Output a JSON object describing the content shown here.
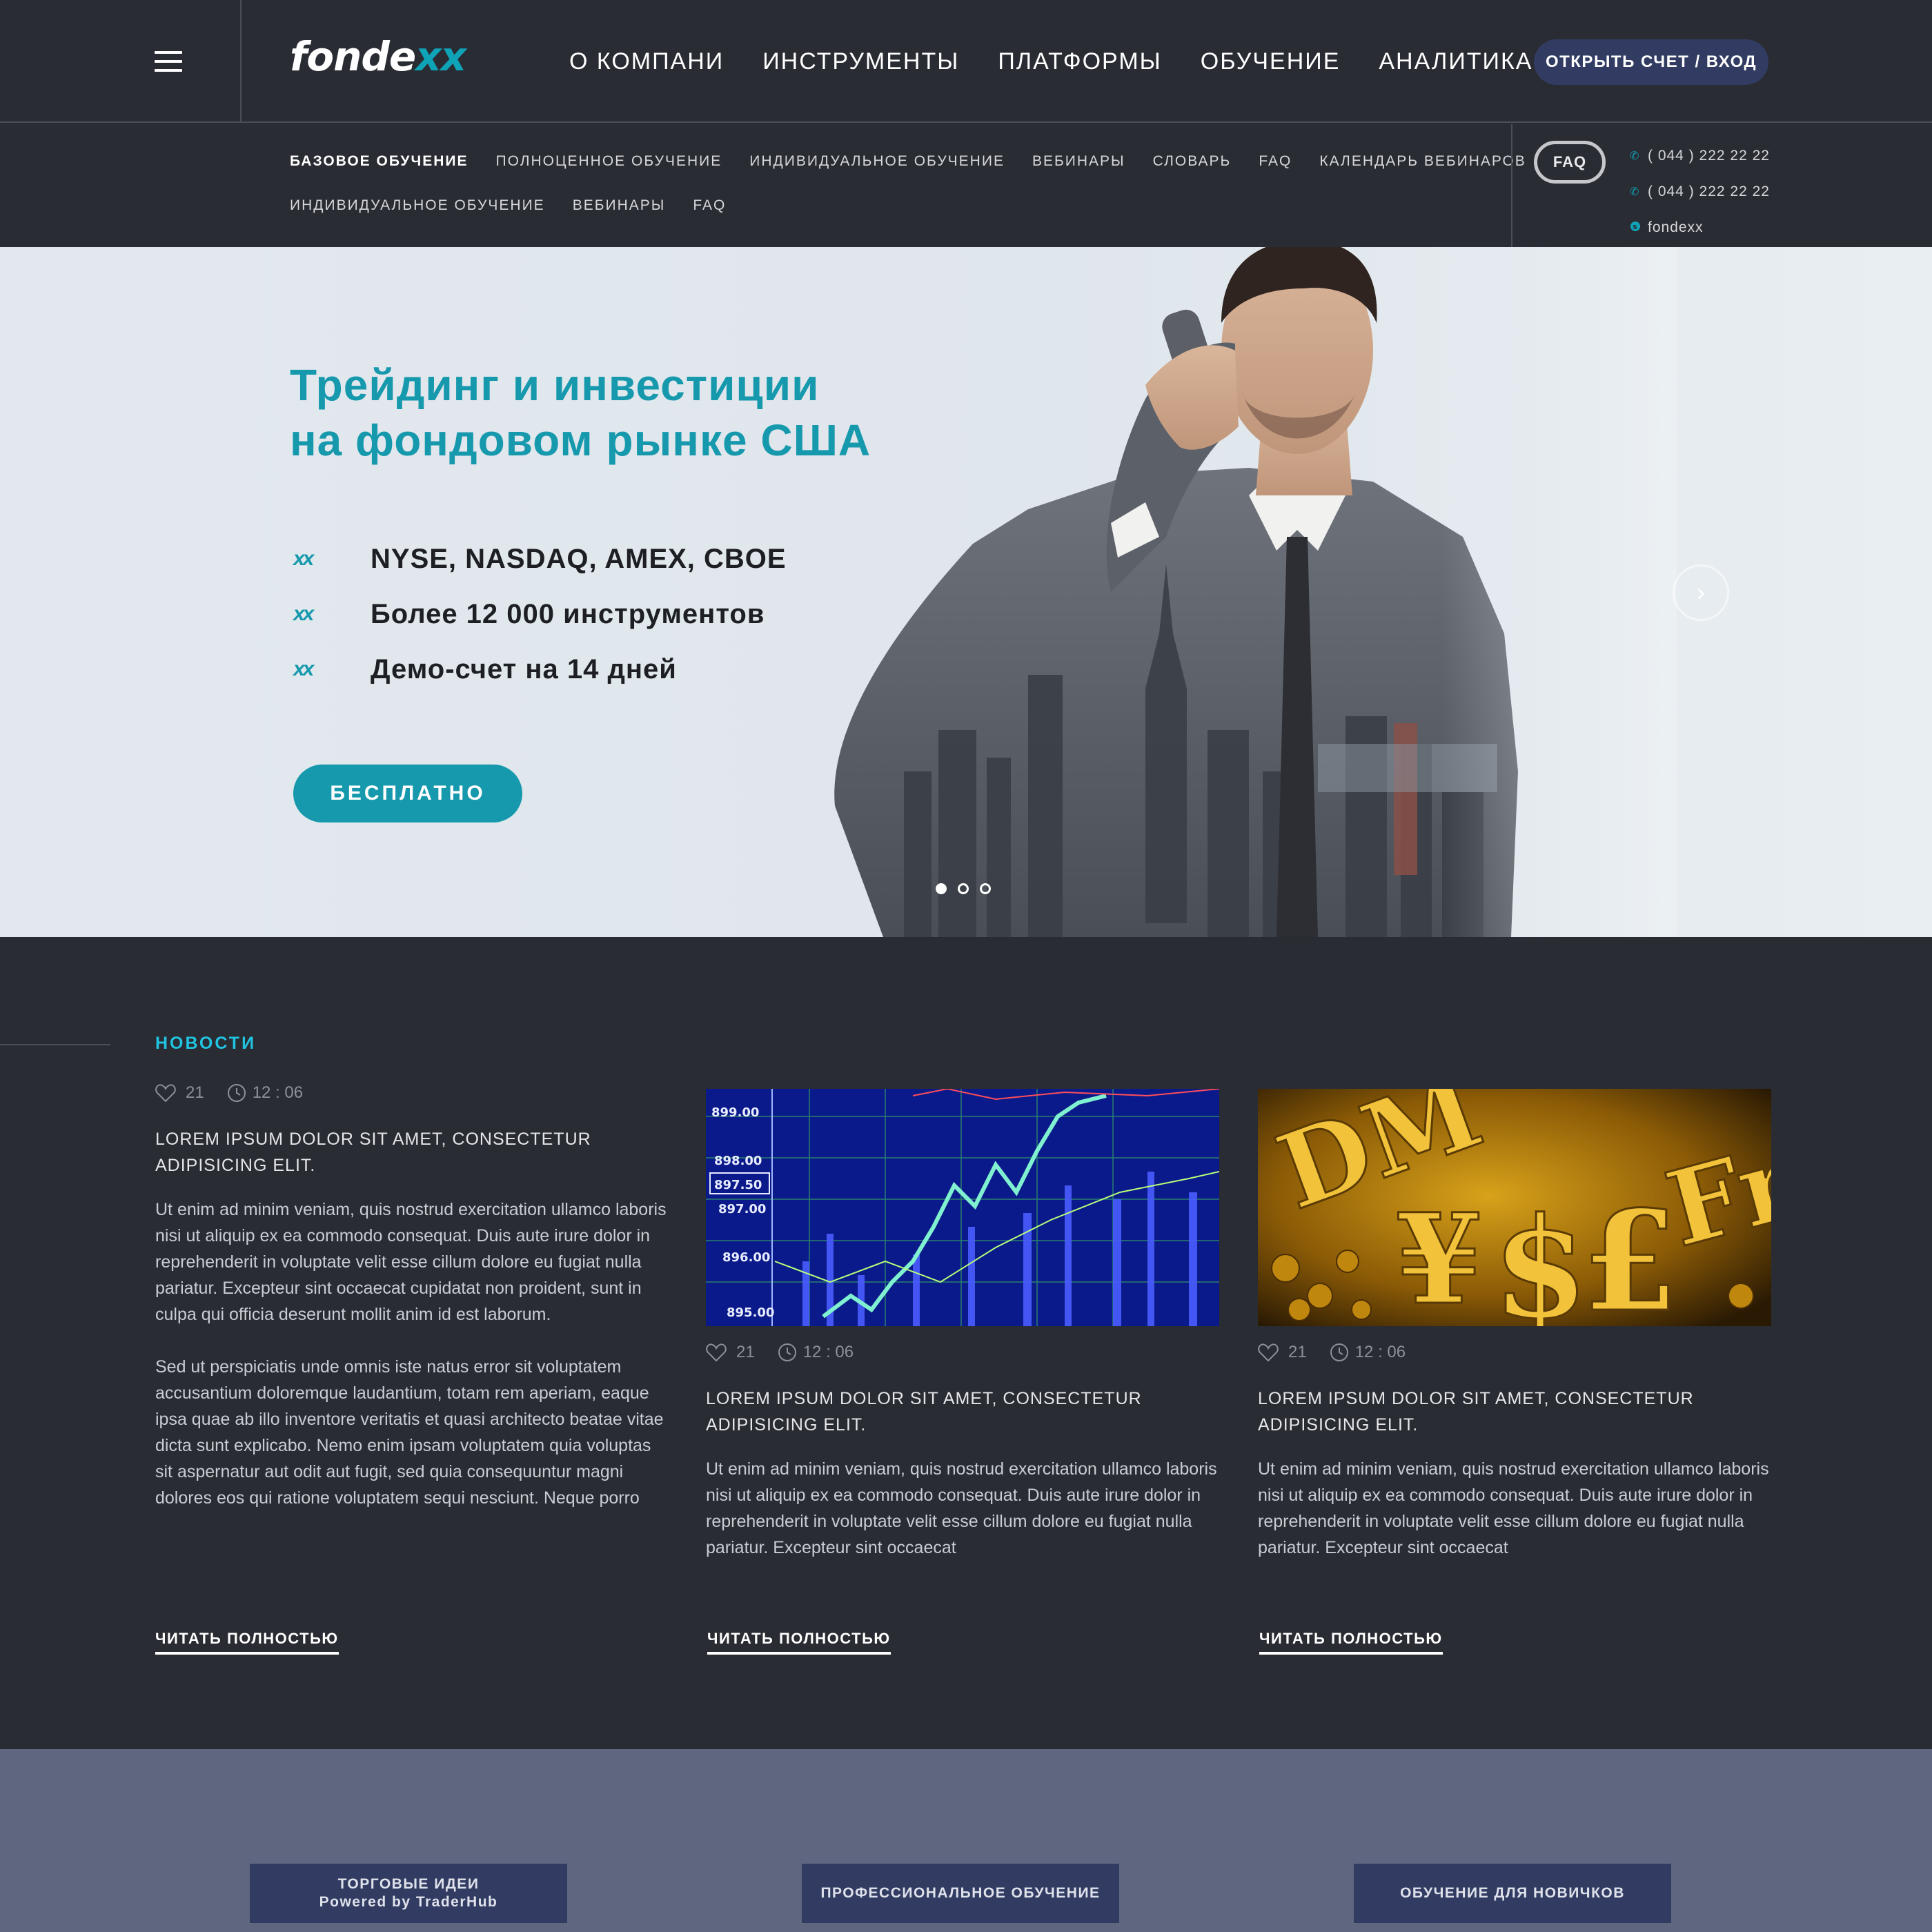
{
  "header": {
    "logo_main": "fonde",
    "logo_accent": "xx",
    "nav": [
      "О КОМПАНИ",
      "ИНСТРУМЕНТЫ",
      "ПЛАТФОРМЫ",
      "ОБУЧЕНИЕ",
      "АНАЛИТИКА"
    ],
    "cta": "ОТКРЫТЬ СЧЕТ / ВХОД"
  },
  "subnav": {
    "row1": [
      "БАЗОВОЕ ОБУЧЕНИЕ",
      "ПОЛНОЦЕННОЕ ОБУЧЕНИЕ",
      "ИНДИВИДУАЛЬНОЕ ОБУЧЕНИЕ",
      "ВЕБИНАРЫ",
      "СЛОВАРЬ",
      "FAQ",
      "КАЛЕНДАРЬ ВЕБИНАРОВ"
    ],
    "row2": [
      "ИНДИВИДУАЛЬНОЕ ОБУЧЕНИЕ",
      "ВЕБИНАРЫ",
      "FAQ"
    ],
    "faq_button": "FAQ",
    "phone1": "( 044 ) 222 22 22",
    "phone2": "( 044 ) 222 22 22",
    "skype": "fondexx"
  },
  "hero": {
    "title_line1": "Трейдинг и инвестиции",
    "title_line2": "на фондовом рынке США",
    "features": [
      "NYSE, NASDAQ, AMEX, CBOE",
      "Более 12 000 инструментов",
      "Демо-счет на 14 дней"
    ],
    "feature_mark": "xx",
    "button": "БЕСПЛАТНО",
    "next_arrow": "›"
  },
  "news": {
    "section_title": "НОВОСТИ",
    "read_more": "ЧИТАТЬ ПОЛНОСТЬЮ",
    "items": [
      {
        "likes": "21",
        "time": "12 : 06",
        "title": "LOREM IPSUM DOLOR SIT AMET, CONSECTETUR ADIPISICING ELIT.",
        "para1": "Ut enim ad minim veniam, quis nostrud exercitation ullamco laboris nisi ut aliquip ex ea commodo consequat. Duis aute irure dolor in reprehenderit in voluptate velit esse cillum dolore eu fugiat nulla pariatur. Excepteur sint occaecat cupidatat non proident, sunt in culpa qui officia deserunt mollit anim id est laborum.",
        "para2": "Sed ut perspiciatis unde omnis iste natus error sit voluptatem accusantium doloremque laudantium, totam rem aperiam, eaque ipsa quae ab illo inventore veritatis et quasi architecto beatae vitae dicta sunt explicabo. Nemo enim ipsam voluptatem quia voluptas sit aspernatur aut odit aut fugit, sed quia consequuntur magni dolores eos qui ratione voluptatem sequi nesciunt. Neque porro"
      },
      {
        "likes": "21",
        "time": "12 : 06",
        "title": "LOREM IPSUM DOLOR SIT AMET, CONSECTETUR ADIPISICING ELIT.",
        "para1": "Ut enim ad minim veniam, quis nostrud exercitation ullamco laboris nisi ut aliquip ex ea commodo consequat. Duis aute irure dolor in reprehenderit in voluptate velit esse cillum dolore eu fugiat nulla pariatur. Excepteur sint occaecat",
        "image_labels": [
          "899.00",
          "898.00",
          "897.50",
          "897.00",
          "896.00",
          "895.00"
        ]
      },
      {
        "likes": "21",
        "time": "12 : 06",
        "title": "LOREM IPSUM DOLOR SIT AMET, CONSECTETUR ADIPISICING ELIT.",
        "para1": "Ut enim ad minim veniam, quis nostrud exercitation ullamco laboris nisi ut aliquip ex ea commodo consequat. Duis aute irure dolor in reprehenderit in voluptate velit esse cillum dolore eu fugiat nulla pariatur. Excepteur sint occaecat"
      }
    ]
  },
  "bottom": {
    "btn1_line1": "ТОРГОВЫЕ ИДЕИ",
    "btn1_line2": "Powered by TraderHub",
    "btn2": "ПРОФЕССИОНАЛЬНОЕ ОБУЧЕНИЕ",
    "btn3": "ОБУЧЕНИЕ ДЛЯ НОВИЧКОВ"
  },
  "colors": {
    "dark_bg": "#2a2c33",
    "accent": "#1799ad",
    "news_accent": "#20c4e0",
    "navy_button": "#323c63",
    "band": "#5f6780"
  }
}
